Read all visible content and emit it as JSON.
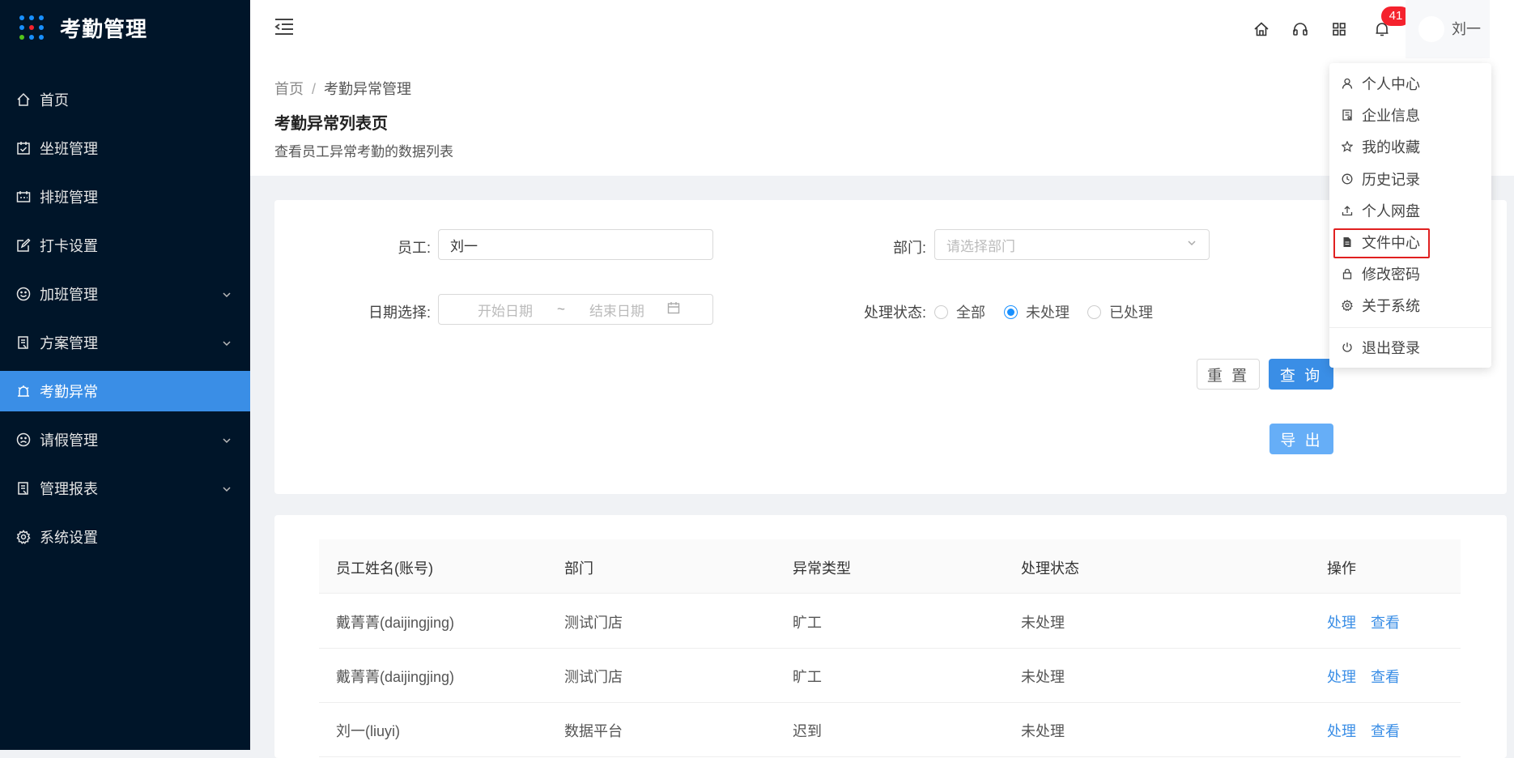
{
  "app": {
    "title": "考勤管理"
  },
  "sidebar": {
    "items": [
      {
        "label": "首页",
        "icon": "home-icon",
        "active": false,
        "expandable": false
      },
      {
        "label": "坐班管理",
        "icon": "calendar-check-icon",
        "active": false,
        "expandable": false
      },
      {
        "label": "排班管理",
        "icon": "schedule-icon",
        "active": false,
        "expandable": false
      },
      {
        "label": "打卡设置",
        "icon": "edit-icon",
        "active": false,
        "expandable": false
      },
      {
        "label": "加班管理",
        "icon": "smile-icon",
        "active": false,
        "expandable": true
      },
      {
        "label": "方案管理",
        "icon": "document-icon",
        "active": false,
        "expandable": true
      },
      {
        "label": "考勤异常",
        "icon": "alarm-icon",
        "active": true,
        "expandable": false
      },
      {
        "label": "请假管理",
        "icon": "frown-icon",
        "active": false,
        "expandable": true
      },
      {
        "label": "管理报表",
        "icon": "report-icon",
        "active": false,
        "expandable": true
      },
      {
        "label": "系统设置",
        "icon": "gear-icon",
        "active": false,
        "expandable": false
      }
    ]
  },
  "topbar": {
    "notification_count": "41",
    "user_name": "刘一",
    "icons": [
      "home-icon",
      "headset-icon",
      "apps-icon",
      "bell-icon",
      "more-icon"
    ]
  },
  "breadcrumb": {
    "home": "首页",
    "separator": "/",
    "current": "考勤异常管理"
  },
  "page": {
    "title": "考勤异常列表页",
    "description": "查看员工异常考勤的数据列表"
  },
  "filters": {
    "employee_label": "员工:",
    "employee_value": "刘一",
    "department_label": "部门:",
    "department_placeholder": "请选择部门",
    "date_label": "日期选择:",
    "start_placeholder": "开始日期",
    "date_separator": "~",
    "end_placeholder": "结束日期",
    "status_label": "处理状态:",
    "status_options": [
      "全部",
      "未处理",
      "已处理"
    ],
    "status_selected": "未处理",
    "reset_label": "重 置",
    "query_label": "查 询",
    "export_label": "导 出"
  },
  "table": {
    "columns": [
      "员工姓名(账号)",
      "部门",
      "异常类型",
      "处理状态",
      "操作"
    ],
    "rows": [
      {
        "name": "戴菁菁(daijingjing)",
        "dept": "测试门店",
        "type": "旷工",
        "status": "未处理",
        "action1": "处理",
        "action2": "查看"
      },
      {
        "name": "戴菁菁(daijingjing)",
        "dept": "测试门店",
        "type": "旷工",
        "status": "未处理",
        "action1": "处理",
        "action2": "查看"
      },
      {
        "name": "刘一(liuyi)",
        "dept": "数据平台",
        "type": "迟到",
        "status": "未处理",
        "action1": "处理",
        "action2": "查看"
      }
    ]
  },
  "user_menu": {
    "items": [
      {
        "label": "个人中心",
        "icon": "user-icon"
      },
      {
        "label": "企业信息",
        "icon": "company-icon"
      },
      {
        "label": "我的收藏",
        "icon": "star-icon"
      },
      {
        "label": "历史记录",
        "icon": "clock-icon"
      },
      {
        "label": "个人网盘",
        "icon": "upload-icon"
      },
      {
        "label": "文件中心",
        "icon": "file-icon"
      },
      {
        "label": "修改密码",
        "icon": "lock-icon"
      },
      {
        "label": "关于系统",
        "icon": "gear-icon"
      },
      {
        "label": "退出登录",
        "icon": "power-icon"
      }
    ],
    "highlighted": "文件中心"
  },
  "colors": {
    "sidebar_bg": "#001529",
    "accent": "#3a8ee6",
    "badge": "#f5222d",
    "highlight_border": "#e02020"
  }
}
